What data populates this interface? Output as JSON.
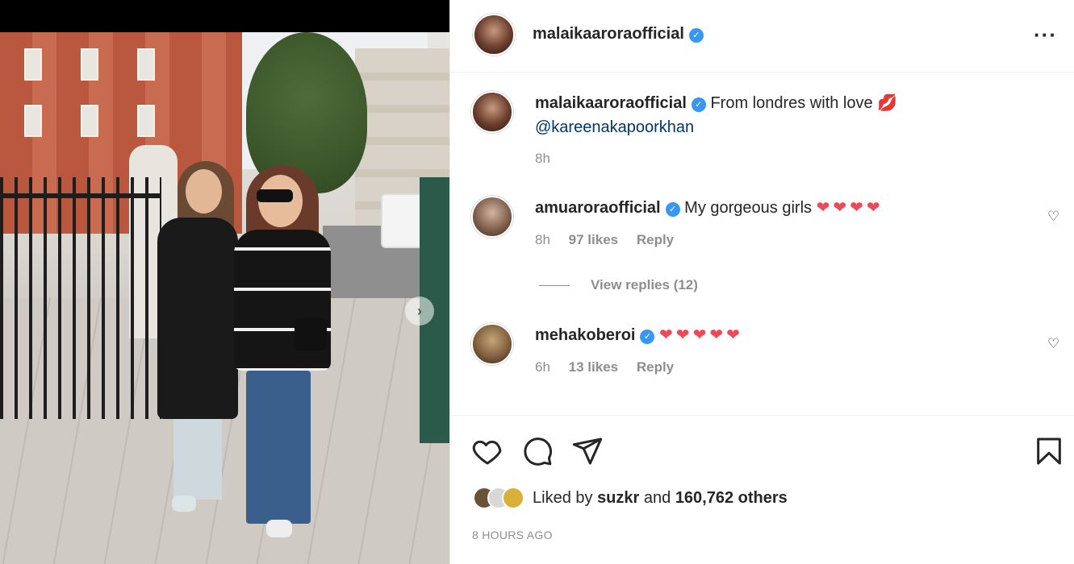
{
  "post": {
    "author": "malaikaaroraofficial",
    "more_icon": "more-horizontal-icon",
    "caption_author": "malaikaaroraofficial",
    "caption_text": "From londres with love",
    "caption_emoji": "💋",
    "caption_mention": "@kareenakapoorkhan",
    "caption_time": "8h"
  },
  "comments": [
    {
      "user": "amuaroraofficial",
      "text": "My gorgeous girls",
      "emoji": "❤❤❤❤",
      "time": "8h",
      "likes": "97 likes",
      "reply": "Reply",
      "view_replies": "View replies (12)"
    },
    {
      "user": "mehakoberoi",
      "text": "",
      "emoji": "❤❤❤❤❤",
      "time": "6h",
      "likes": "13 likes",
      "reply": "Reply"
    }
  ],
  "actions": {
    "like_icon": "heart-icon",
    "comment_icon": "comment-icon",
    "share_icon": "send-icon",
    "save_icon": "bookmark-icon"
  },
  "likes": {
    "prefix": "Liked by",
    "user": "suzkr",
    "middle": "and",
    "count": "160,762 others"
  },
  "timestamp": "8 HOURS AGO",
  "colors": {
    "verified": "#3897f0",
    "heart": "#ed4956",
    "mention": "#00376b",
    "muted": "#8e8e8e"
  }
}
